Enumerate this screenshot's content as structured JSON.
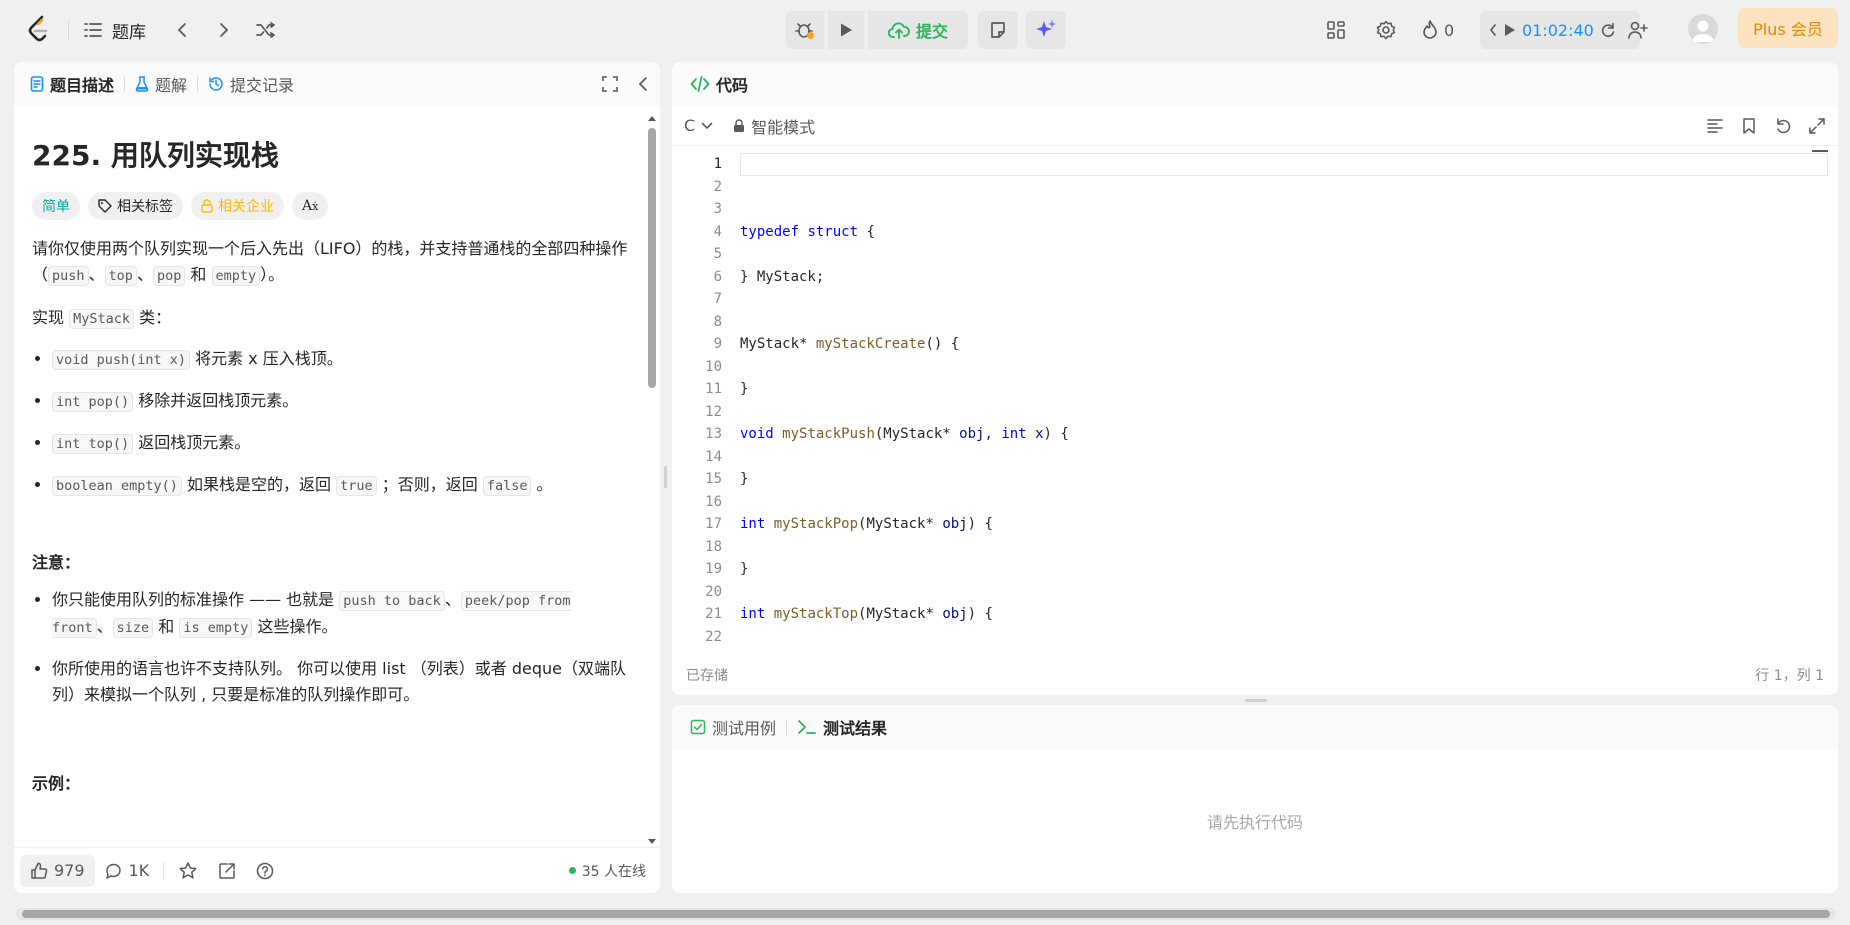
{
  "topbar": {
    "problem_list_label": "题库",
    "submit_label": "提交",
    "streak_count": "0",
    "timer": "01:02:40",
    "plus_label": "Plus 会员"
  },
  "left_tabs": [
    {
      "label": "题目描述"
    },
    {
      "label": "题解"
    },
    {
      "label": "提交记录"
    }
  ],
  "problem": {
    "title": "225. 用队列实现栈",
    "tag_difficulty": "简单",
    "tag_topics": "相关标签",
    "tag_companies": "相关企业",
    "intro_1": "请你仅使用两个队列实现一个后入先出（LIFO）的栈，并支持普通栈的全部四种操作（",
    "intro_code_1": "push",
    "intro_sep_1": "、",
    "intro_code_2": "top",
    "intro_sep_2": "、",
    "intro_code_3": "pop",
    "intro_and": " 和 ",
    "intro_code_4": "empty",
    "intro_end": "）。",
    "impl_prefix": "实现 ",
    "impl_code": "MyStack",
    "impl_suffix": " 类：",
    "methods": [
      {
        "code": "void push(int x)",
        "text": " 将元素 x 压入栈顶。"
      },
      {
        "code": "int pop()",
        "text": " 移除并返回栈顶元素。"
      },
      {
        "code": "int top()",
        "text": " 返回栈顶元素。"
      }
    ],
    "empty_method_code": "boolean empty()",
    "empty_method_text_1": " 如果栈是空的，返回 ",
    "empty_method_true": "true",
    "empty_method_text_2": " ；否则，返回 ",
    "empty_method_false": "false",
    "empty_method_text_3": " 。",
    "note_heading": "注意：",
    "note_1_prefix": "你只能使用队列的标准操作 —— 也就是 ",
    "note_1_code_1": "push to back",
    "note_1_sep_1": "、",
    "note_1_code_2": "peek/pop from front",
    "note_1_sep_2": "、",
    "note_1_code_3": "size",
    "note_1_and": " 和 ",
    "note_1_code_4": "is empty",
    "note_1_suffix": " 这些操作。",
    "note_2": "你所使用的语言也许不支持队列。 你可以使用 list （列表）或者 deque（双端队列）来模拟一个队列 , 只要是标准的队列操作即可。",
    "example_heading": "示例："
  },
  "footer": {
    "likes": "979",
    "comments": "1K",
    "online": "35 人在线"
  },
  "code_panel": {
    "tab_label": "代码",
    "language": "C",
    "mode": "智能模式",
    "saved_status": "已存储",
    "cursor_pos": "行 1，列 1",
    "line_numbers": [
      "1",
      "2",
      "3",
      "4",
      "5",
      "6",
      "7",
      "8",
      "9",
      "10",
      "11",
      "12",
      "13",
      "14",
      "15",
      "16",
      "17",
      "18",
      "19",
      "20",
      "21",
      "22"
    ]
  },
  "test_panel": {
    "tab_cases": "测试用例",
    "tab_results": "测试结果",
    "placeholder": "请先执行代码"
  }
}
